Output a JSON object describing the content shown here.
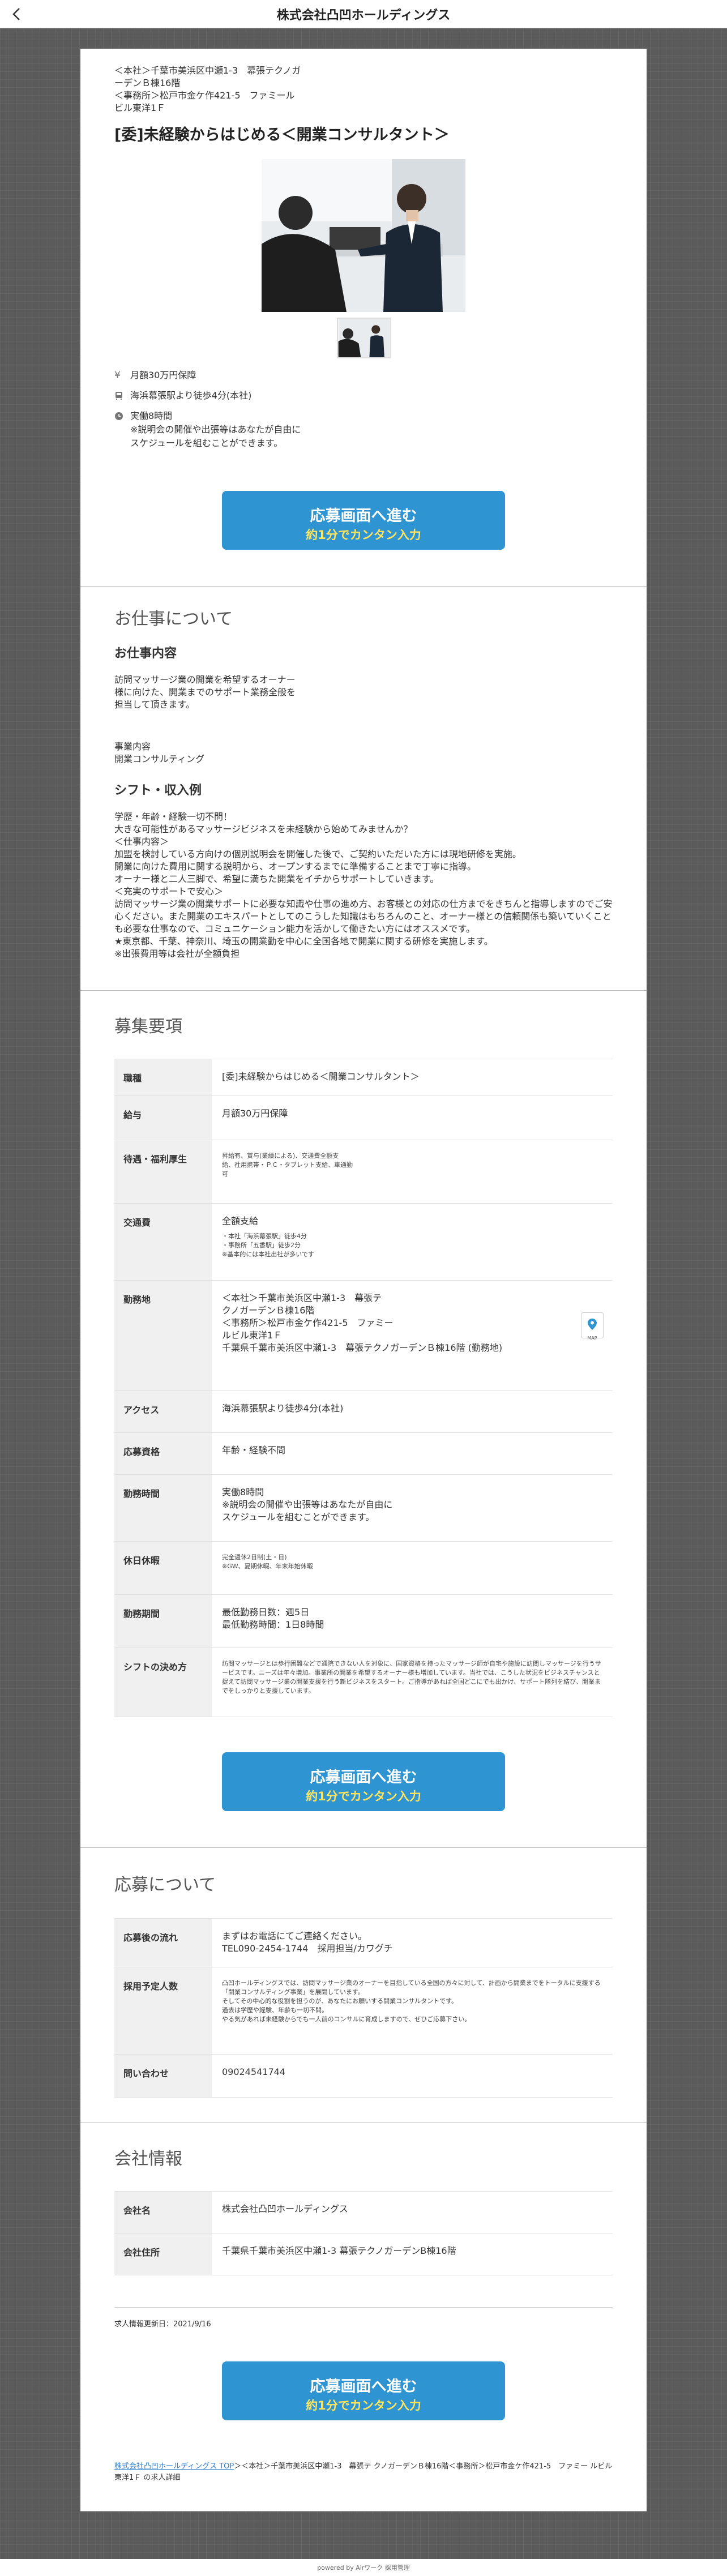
{
  "header": {
    "title": "株式会社凸凹ホールディングス",
    "back_icon": "chevron-left-icon"
  },
  "hero": {
    "address": "＜本社＞千葉市美浜区中瀬1-3　幕張テクノガーデンＢ棟16階\n＜事務所＞松戸市金ケ作421-5　ファミールビル東洋1Ｆ",
    "job_title": "[委]未経験からはじめる＜開業コンサルタント＞",
    "info": [
      {
        "icon": "yen-icon",
        "text": "月額30万円保障"
      },
      {
        "icon": "train-icon",
        "text": "海浜幕張駅より徒歩4分(本社)"
      },
      {
        "icon": "clock-icon",
        "text": "実働8時間\n※説明会の開催や出張等はあなたが自由に\nスケジュールを組むことができます。"
      }
    ]
  },
  "cta": {
    "line1": "応募画面へ進む",
    "line2": "約1分でカンタン入力"
  },
  "about": {
    "title": "お仕事について",
    "work_heading": "お仕事内容",
    "work_text": "訪問マッサージ業の開業を希望するオーナー様に向けた、開業までのサポート業務全般を担当して頂きます。",
    "work_detail": "事業内容\n開業コンサルティング",
    "shift_heading": "シフト・収入例",
    "shift_text": "学歴・年齢・経験一切不問！\n大きな可能性があるマッサージビジネスを未経験から始めてみませんか？\n＜仕事内容＞\n加盟を検討している方向けの個別説明会を開催した後で、ご契約いただいた方には現地研修を実施。\n開業に向けた費用に関する説明から、オープンするまでに準備することまで丁寧に指導。\nオーナー様と二人三脚で、希望に満ちた開業をイチからサポートしていきます。\n＜充実のサポートで安心＞\n訪問マッサージ業の開業サポートに必要な知識や仕事の進め方、お客様との対応の仕方までをきちんと指導しますのでご安心ください。また開業のエキスパートとしてのこうした知識はもちろんのこと、オーナー様との信頼関係も築いていくことも必要な仕事なので、コミュニケーション能力を活かして働きたい方にはオススメです。\n★東京都、千葉、神奈川、埼玉の開業勤を中心に全国各地で開業に関する研修を実施します。\n※出張費用等は会社が全額負担"
  },
  "recruit": {
    "title": "募集要項",
    "rows": [
      {
        "label": "職種",
        "value": "[委]未経験からはじめる＜開業コンサルタント＞"
      },
      {
        "label": "給与",
        "value": "月額30万円保障"
      },
      {
        "label": "待遇・福利厚生",
        "value": "",
        "small": "昇給有、賞与(業績による)、交通費全額支\n給、社用携帯・ＰＣ・タブレット支給、車通勤\n可"
      },
      {
        "label": "交通費",
        "value": "全額支給",
        "small": "・本社「海浜幕張駅」徒歩4分\n・事務所「五香駅」徒歩2分\n※基本的には本社出社が多いです"
      },
      {
        "label": "勤務地",
        "value": "＜本社＞千葉市美浜区中瀬1-3　幕張テ\nクノガーデンＢ棟16階\n＜事務所＞松戸市金ケ作421-5　ファミー\nルビル東洋1Ｆ\n千葉県千葉市美浜区中瀬1-3　幕張テクノガーデンＢ棟16階 (勤務地)",
        "map_label": "MAP"
      },
      {
        "label": "アクセス",
        "value": "海浜幕張駅より徒歩4分(本社)"
      },
      {
        "label": "応募資格",
        "value": "年齢・経験不問"
      },
      {
        "label": "勤務時間",
        "value": "実働8時間\n※説明会の開催や出張等はあなたが自由に\nスケジュールを組むことができます。"
      },
      {
        "label": "休日休暇",
        "value": "",
        "small": "完全週休2日制(土・日)\n※GW、夏期休暇、年末年始休暇"
      },
      {
        "label": "勤務期間",
        "value": "最低勤務日数：週5日\n最低勤務時間：1日8時間"
      },
      {
        "label": "シフトの決め方",
        "value": "",
        "small": "訪問マッサージとは歩行困難などで通院できない人を対象に、国家資格を持ったマッサージ師が自宅や施設に訪問しマッサージを行うサービスです。ニーズは年々増加。事業所の開業を希望するオーナー様も増加しています。当社では、こうした状況をビジネスチャンスと捉えて訪問マッサージ業の開業支援を行う新ビジネスをスタート。ご指導があれば全国どこにでも出かけ、サポート隊列を結び、開業までをしっかりと支援しています。"
      }
    ]
  },
  "apply": {
    "title": "応募について",
    "rows": [
      {
        "label": "応募後の流れ",
        "value": "まずはお電話にてご連絡ください。\nTEL090-2454-1744　採用担当/カワグチ"
      },
      {
        "label": "採用予定人数",
        "value": "",
        "small": "凸凹ホールディングスでは、訪問マッサージ業のオーナーを目指している全国の方々に対して、計画から開業までをトータルに支援する「開業コンサルティング事業」を展開しています。\nそしてその中心的な役割を担うのが、あなたにお願いする開業コンサルタントです。\n過去は学歴や経験、年齢も一切不問。\nやる気があれば未経験からでも一人前のコンサルに育成しますので、ぜひご応募下さい。"
      },
      {
        "label": "問い合わせ",
        "value": "09024541744"
      }
    ]
  },
  "company": {
    "title": "会社情報",
    "rows": [
      {
        "label": "会社名",
        "value": "株式会社凸凹ホールディングス"
      },
      {
        "label": "会社住所",
        "value": "千葉県千葉市美浜区中瀬1-3 幕張テクノガーデンB棟16階"
      }
    ],
    "updated": "求人情報更新日：2021/9/16"
  },
  "breadcrumb": {
    "link": "株式会社凸凹ホールディングス TOP",
    "rest": "＞＜本社＞千葉市美浜区中瀬1-3　幕張テ クノガーデンＢ棟16階＜事務所＞松戸市金ケ作421-5　ファミー ルビル東洋1Ｆ の求人詳細"
  },
  "footer": {
    "text": "powered by Airワーク 採用管理"
  }
}
